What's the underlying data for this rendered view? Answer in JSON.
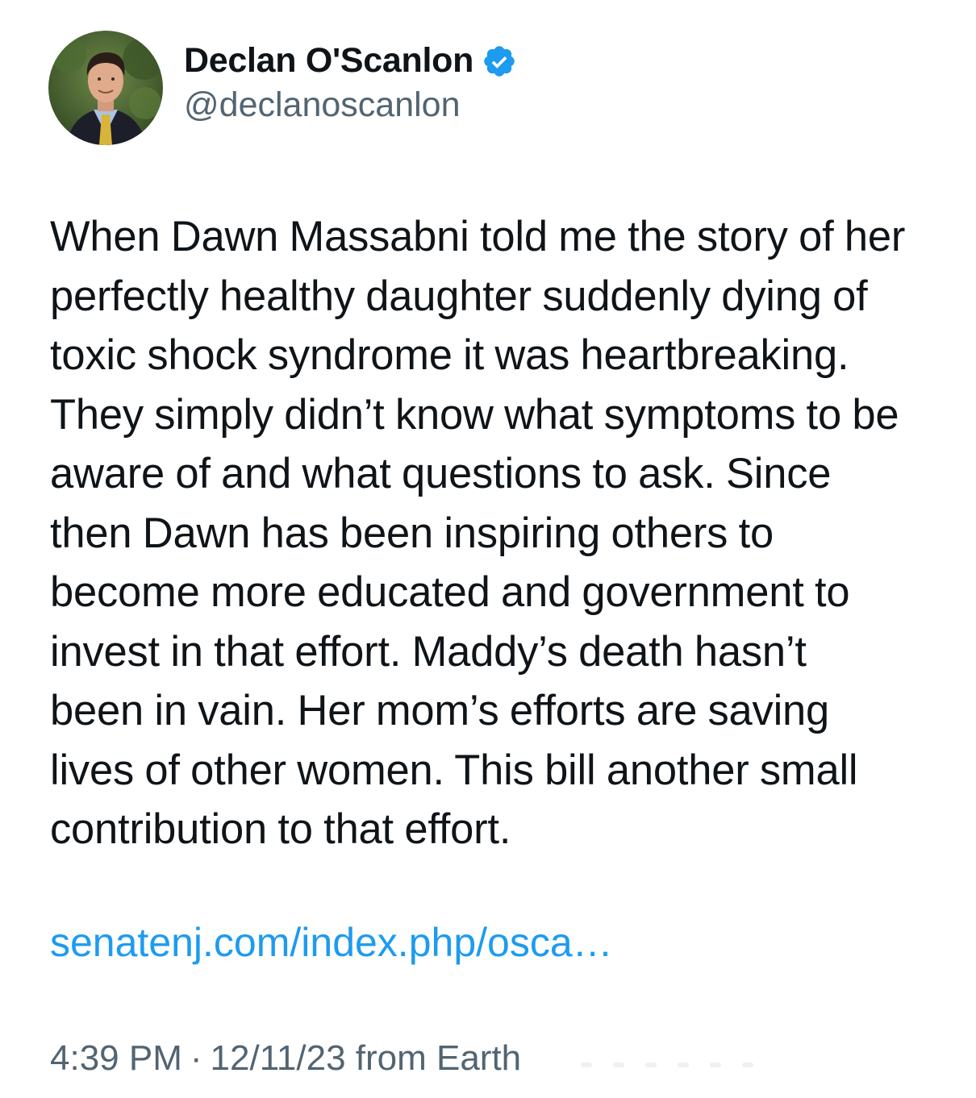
{
  "author": {
    "display_name": "Declan O'Scanlon",
    "handle": "@declanoscanlon",
    "avatar_icon": "profile-photo",
    "verified_icon": "verified-badge-icon",
    "verified_color": "#1d9bf0"
  },
  "tweet": {
    "lines": [
      "When Dawn Massabni told me the story of her",
      "perfectly healthy daughter suddenly dying of",
      "toxic shock syndrome it was heartbreaking.",
      "They simply didn’t know what symptoms to be",
      "aware of and what questions to ask. Since",
      "then Dawn has been inspiring others to",
      "become more educated and government to",
      "invest in that effort. Maddy’s death hasn’t",
      "been in vain. Her mom’s efforts are saving",
      "lives of other women. This bill another small",
      "contribution to that effort."
    ],
    "link_text": "senatenj.com/index.php/osca…",
    "link_color": "#1d9bf0"
  },
  "meta": {
    "time": "4:39 PM",
    "separator": "·",
    "date_source": "12/11/23 from Earth"
  }
}
